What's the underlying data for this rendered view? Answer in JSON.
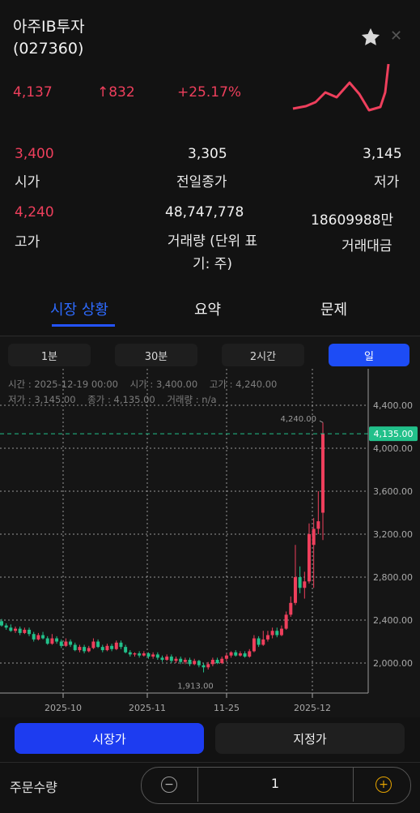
{
  "stock": {
    "name": "아주IB투자",
    "code": "(027360)",
    "price": "4,137",
    "change": "↑832",
    "change_pct": "+25.17%"
  },
  "stats": {
    "open_value": "3,400",
    "open_label": "시가",
    "prev_close_value": "3,305",
    "prev_close_label": "전일종가",
    "low_value": "3,145",
    "low_label": "저가",
    "high_value": "4,240",
    "high_label": "고가",
    "volume_value": "48,747,778",
    "volume_label": "거래량 (단위 표\n기: 주)",
    "amount_value": "18609988만",
    "amount_label": "거래대금"
  },
  "tabs": [
    "시장 상황",
    "요약",
    "문제"
  ],
  "periods": [
    "1분",
    "30분",
    "2시간",
    "일"
  ],
  "chart_info": {
    "line1": "시간 : 2025-12-19 00:00    시가 : 3,400.00    고가 : 4,240.00",
    "line2": "저가 : 3,145.00    종가 : 4,135.00    거래량 : n/a"
  },
  "colors": {
    "up": "#ee3f5c",
    "down": "#22c08a",
    "accent": "#1d4cf5",
    "background": "#121212"
  },
  "chart_data": {
    "type": "candlestick",
    "x_ticks": [
      "2025-10",
      "2025-11",
      "11-25",
      "2025-12"
    ],
    "y_ticks": [
      "4,400.00",
      "4,000.00",
      "3,600.00",
      "3,200.00",
      "2,800.00",
      "2,400.00",
      "2,000.00"
    ],
    "ylim": [
      1800,
      4800
    ],
    "current_price_label": "4,135.00",
    "high_annotation": "4,240.00",
    "low_annotation": "1,913.00",
    "grid": true,
    "candles": [
      {
        "o": 2390,
        "c": 2350,
        "h": 2410,
        "l": 2340
      },
      {
        "o": 2350,
        "c": 2330,
        "h": 2370,
        "l": 2310
      },
      {
        "o": 2330,
        "c": 2300,
        "h": 2360,
        "l": 2290
      },
      {
        "o": 2300,
        "c": 2320,
        "h": 2340,
        "l": 2280
      },
      {
        "o": 2320,
        "c": 2280,
        "h": 2340,
        "l": 2260
      },
      {
        "o": 2280,
        "c": 2310,
        "h": 2330,
        "l": 2270
      },
      {
        "o": 2310,
        "c": 2270,
        "h": 2330,
        "l": 2250
      },
      {
        "o": 2270,
        "c": 2220,
        "h": 2290,
        "l": 2200
      },
      {
        "o": 2220,
        "c": 2260,
        "h": 2280,
        "l": 2210
      },
      {
        "o": 2260,
        "c": 2230,
        "h": 2290,
        "l": 2220
      },
      {
        "o": 2230,
        "c": 2180,
        "h": 2250,
        "l": 2170
      },
      {
        "o": 2180,
        "c": 2230,
        "h": 2270,
        "l": 2170
      },
      {
        "o": 2230,
        "c": 2200,
        "h": 2250,
        "l": 2180
      },
      {
        "o": 2200,
        "c": 2160,
        "h": 2220,
        "l": 2140
      },
      {
        "o": 2160,
        "c": 2200,
        "h": 2230,
        "l": 2150
      },
      {
        "o": 2200,
        "c": 2170,
        "h": 2220,
        "l": 2150
      },
      {
        "o": 2170,
        "c": 2120,
        "h": 2190,
        "l": 2110
      },
      {
        "o": 2120,
        "c": 2150,
        "h": 2170,
        "l": 2100
      },
      {
        "o": 2150,
        "c": 2110,
        "h": 2170,
        "l": 2090
      },
      {
        "o": 2110,
        "c": 2140,
        "h": 2160,
        "l": 2100
      },
      {
        "o": 2140,
        "c": 2200,
        "h": 2230,
        "l": 2130
      },
      {
        "o": 2200,
        "c": 2150,
        "h": 2220,
        "l": 2140
      },
      {
        "o": 2150,
        "c": 2120,
        "h": 2170,
        "l": 2100
      },
      {
        "o": 2120,
        "c": 2160,
        "h": 2180,
        "l": 2110
      },
      {
        "o": 2160,
        "c": 2130,
        "h": 2180,
        "l": 2110
      },
      {
        "o": 2130,
        "c": 2190,
        "h": 2210,
        "l": 2120
      },
      {
        "o": 2190,
        "c": 2150,
        "h": 2210,
        "l": 2130
      },
      {
        "o": 2150,
        "c": 2100,
        "h": 2170,
        "l": 2090
      },
      {
        "o": 2100,
        "c": 2080,
        "h": 2120,
        "l": 2060
      },
      {
        "o": 2080,
        "c": 2090,
        "h": 2100,
        "l": 2060
      },
      {
        "o": 2090,
        "c": 2070,
        "h": 2110,
        "l": 2050
      },
      {
        "o": 2070,
        "c": 2090,
        "h": 2110,
        "l": 2060
      },
      {
        "o": 2090,
        "c": 2060,
        "h": 2100,
        "l": 2040
      },
      {
        "o": 2060,
        "c": 2080,
        "h": 2100,
        "l": 2040
      },
      {
        "o": 2080,
        "c": 2050,
        "h": 2100,
        "l": 2030
      },
      {
        "o": 2050,
        "c": 2030,
        "h": 2070,
        "l": 2010
      },
      {
        "o": 2030,
        "c": 2060,
        "h": 2080,
        "l": 2020
      },
      {
        "o": 2060,
        "c": 2020,
        "h": 2080,
        "l": 2000
      },
      {
        "o": 2020,
        "c": 2040,
        "h": 2060,
        "l": 2000
      },
      {
        "o": 2040,
        "c": 2010,
        "h": 2060,
        "l": 1990
      },
      {
        "o": 2010,
        "c": 2030,
        "h": 2050,
        "l": 1990
      },
      {
        "o": 2030,
        "c": 1990,
        "h": 2050,
        "l": 1970
      },
      {
        "o": 1990,
        "c": 2020,
        "h": 2040,
        "l": 1980
      },
      {
        "o": 2020,
        "c": 1980,
        "h": 2030,
        "l": 1960
      },
      {
        "o": 1980,
        "c": 1960,
        "h": 2000,
        "l": 1913
      },
      {
        "o": 1960,
        "c": 1990,
        "h": 2010,
        "l": 1940
      },
      {
        "o": 1990,
        "c": 2030,
        "h": 2050,
        "l": 1970
      },
      {
        "o": 2030,
        "c": 2000,
        "h": 2050,
        "l": 1990
      },
      {
        "o": 2000,
        "c": 2040,
        "h": 2060,
        "l": 1990
      },
      {
        "o": 2040,
        "c": 2070,
        "h": 2090,
        "l": 2020
      },
      {
        "o": 2070,
        "c": 2100,
        "h": 2110,
        "l": 2050
      },
      {
        "o": 2100,
        "c": 2070,
        "h": 2120,
        "l": 2060
      },
      {
        "o": 2070,
        "c": 2090,
        "h": 2110,
        "l": 2060
      },
      {
        "o": 2090,
        "c": 2060,
        "h": 2110,
        "l": 2050
      },
      {
        "o": 2060,
        "c": 2110,
        "h": 2130,
        "l": 2050
      },
      {
        "o": 2110,
        "c": 2230,
        "h": 2260,
        "l": 2100
      },
      {
        "o": 2230,
        "c": 2170,
        "h": 2250,
        "l": 2150
      },
      {
        "o": 2170,
        "c": 2220,
        "h": 2300,
        "l": 2160
      },
      {
        "o": 2220,
        "c": 2260,
        "h": 2300,
        "l": 2200
      },
      {
        "o": 2260,
        "c": 2300,
        "h": 2330,
        "l": 2230
      },
      {
        "o": 2300,
        "c": 2260,
        "h": 2330,
        "l": 2240
      },
      {
        "o": 2260,
        "c": 2320,
        "h": 2350,
        "l": 2250
      },
      {
        "o": 2320,
        "c": 2450,
        "h": 2480,
        "l": 2310
      },
      {
        "o": 2450,
        "c": 2560,
        "h": 2620,
        "l": 2430
      },
      {
        "o": 2560,
        "c": 2800,
        "h": 3100,
        "l": 2540
      },
      {
        "o": 2800,
        "c": 2700,
        "h": 2900,
        "l": 2650
      },
      {
        "o": 2700,
        "c": 2760,
        "h": 2850,
        "l": 2600
      },
      {
        "o": 2760,
        "c": 3200,
        "h": 3300,
        "l": 2740
      },
      {
        "o": 3100,
        "c": 3250,
        "h": 3350,
        "l": 2700
      },
      {
        "o": 3250,
        "c": 3320,
        "h": 3600,
        "l": 3200
      },
      {
        "o": 3400,
        "c": 4135,
        "h": 4240,
        "l": 3145
      }
    ]
  },
  "order": {
    "market_label": "시장가",
    "limit_label": "지정가",
    "qty_label": "주문수량",
    "qty_value": "1",
    "minus": "−",
    "plus": "+"
  }
}
